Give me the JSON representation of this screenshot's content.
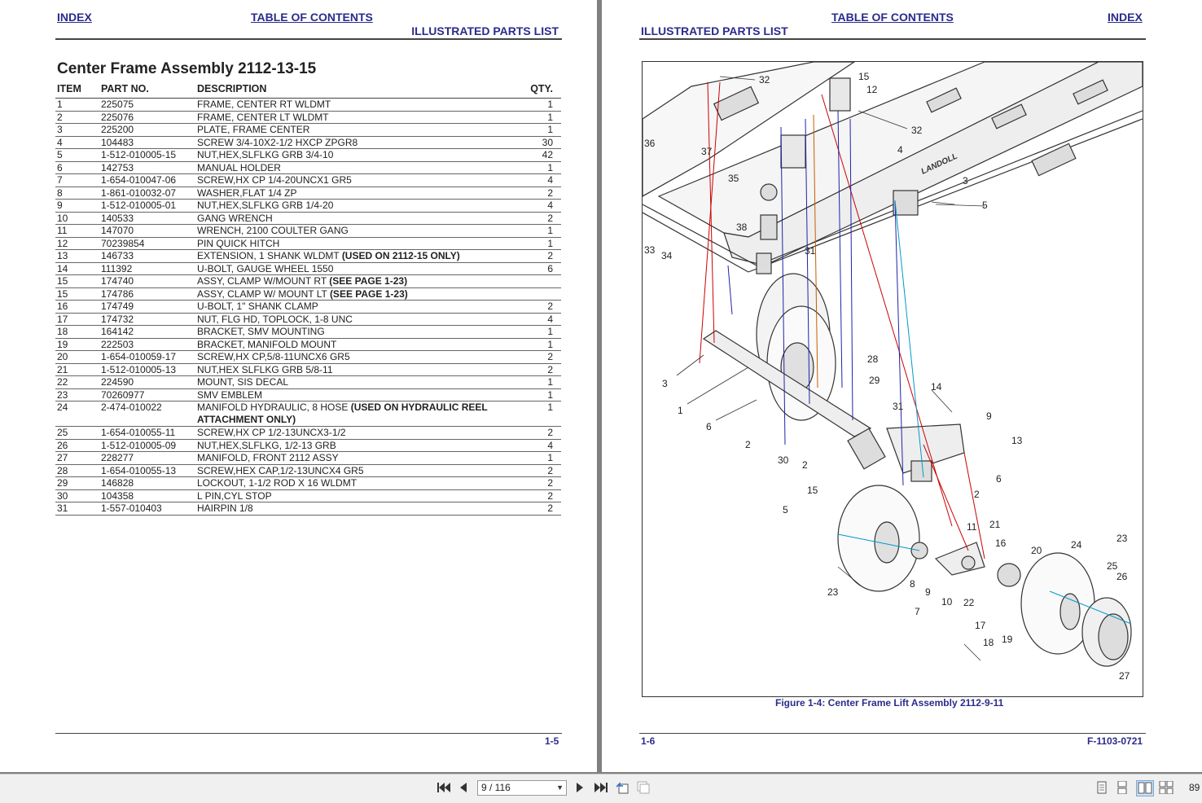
{
  "left_page": {
    "header": {
      "index_link": "INDEX",
      "toc_link": "TABLE OF CONTENTS",
      "section": "ILLUSTRATED PARTS LIST"
    },
    "title": "Center Frame Assembly 2112-13-15",
    "columns": [
      "ITEM",
      "PART NO.",
      "DESCRIPTION",
      "QTY."
    ],
    "rows": [
      {
        "item": "1",
        "part": "225075",
        "desc": "FRAME, CENTER RT WLDMT",
        "note": "",
        "desc2": "",
        "qty": "1"
      },
      {
        "item": "2",
        "part": "225076",
        "desc": "FRAME, CENTER LT WLDMT",
        "note": "",
        "desc2": "",
        "qty": "1"
      },
      {
        "item": "3",
        "part": "225200",
        "desc": "PLATE, FRAME CENTER",
        "note": "",
        "desc2": "",
        "qty": "1"
      },
      {
        "item": "4",
        "part": "104483",
        "desc": "SCREW 3/4-10X2-1/2 HXCP ZPGR8",
        "note": "",
        "desc2": "",
        "qty": "30"
      },
      {
        "item": "5",
        "part": "1-512-010005-15",
        "desc": "NUT,HEX,SLFLKG GRB 3/4-10",
        "note": "",
        "desc2": "",
        "qty": "42"
      },
      {
        "item": "6",
        "part": "142753",
        "desc": "MANUAL HOLDER",
        "note": "",
        "desc2": "",
        "qty": "1"
      },
      {
        "item": "7",
        "part": "1-654-010047-06",
        "desc": "SCREW,HX CP 1/4-20UNCX1 GR5",
        "note": "",
        "desc2": "",
        "qty": "4"
      },
      {
        "item": "8",
        "part": "1-861-010032-07",
        "desc": "WASHER,FLAT 1/4 ZP",
        "note": "",
        "desc2": "",
        "qty": "2"
      },
      {
        "item": "9",
        "part": "1-512-010005-01",
        "desc": "NUT,HEX,SLFLKG GRB 1/4-20",
        "note": "",
        "desc2": "",
        "qty": "4"
      },
      {
        "item": "10",
        "part": "140533",
        "desc": "GANG WRENCH",
        "note": "",
        "desc2": "",
        "qty": "2"
      },
      {
        "item": "11",
        "part": "147070",
        "desc": "WRENCH, 2100 COULTER GANG",
        "note": "",
        "desc2": "",
        "qty": "1"
      },
      {
        "item": "12",
        "part": "70239854",
        "desc": "PIN QUICK HITCH",
        "note": "",
        "desc2": "",
        "qty": "1"
      },
      {
        "item": "13",
        "part": "146733",
        "desc": "EXTENSION, 1 SHANK WLDMT ",
        "note": "(USED ON 2112-15 ONLY)",
        "desc2": "",
        "qty": "2"
      },
      {
        "item": "14",
        "part": "111392",
        "desc": "U-BOLT, GAUGE WHEEL 1550",
        "note": "",
        "desc2": "",
        "qty": "6"
      },
      {
        "item": "15",
        "part": "174740",
        "desc": "ASSY, CLAMP W/MOUNT RT ",
        "note": "(SEE PAGE 1-23)",
        "desc2": "",
        "qty": ""
      },
      {
        "item": "15",
        "part": "174786",
        "desc": "ASSY, CLAMP W/ MOUNT LT ",
        "note": "(SEE PAGE 1-23)",
        "desc2": "",
        "qty": ""
      },
      {
        "item": "16",
        "part": "174749",
        "desc": "U-BOLT, 1\" SHANK CLAMP",
        "note": "",
        "desc2": "",
        "qty": "2"
      },
      {
        "item": "17",
        "part": "174732",
        "desc": "NUT, FLG HD, TOPLOCK, 1-8 UNC",
        "note": "",
        "desc2": "",
        "qty": "4"
      },
      {
        "item": "18",
        "part": "164142",
        "desc": "BRACKET, SMV MOUNTING",
        "note": "",
        "desc2": "",
        "qty": "1"
      },
      {
        "item": "19",
        "part": "222503",
        "desc": "BRACKET, MANIFOLD MOUNT",
        "note": "",
        "desc2": "",
        "qty": "1"
      },
      {
        "item": "20",
        "part": "1-654-010059-17",
        "desc": "SCREW,HX CP,5/8-11UNCX6 GR5",
        "note": "",
        "desc2": "",
        "qty": "2"
      },
      {
        "item": "21",
        "part": "1-512-010005-13",
        "desc": "NUT,HEX SLFLKG GRB 5/8-11",
        "note": "",
        "desc2": "",
        "qty": "2"
      },
      {
        "item": "22",
        "part": "224590",
        "desc": "MOUNT, SIS DECAL",
        "note": "",
        "desc2": "",
        "qty": "1"
      },
      {
        "item": "23",
        "part": "70260977",
        "desc": "SMV EMBLEM",
        "note": "",
        "desc2": "",
        "qty": "1"
      },
      {
        "item": "24",
        "part": "2-474-010022",
        "desc": "MANIFOLD HYDRAULIC, 8 HOSE ",
        "note": "(USED ON HYDRAULIC REEL",
        "desc2": "ATTACHMENT ONLY)",
        "qty": "1"
      },
      {
        "item": "25",
        "part": "1-654-010055-11",
        "desc": "SCREW,HX CP 1/2-13UNCX3-1/2",
        "note": "",
        "desc2": "",
        "qty": "2"
      },
      {
        "item": "26",
        "part": "1-512-010005-09",
        "desc": "NUT,HEX,SLFLKG, 1/2-13 GRB",
        "note": "",
        "desc2": "",
        "qty": "4"
      },
      {
        "item": "27",
        "part": "228277",
        "desc": "MANIFOLD, FRONT 2112 ASSY",
        "note": "",
        "desc2": "",
        "qty": "1"
      },
      {
        "item": "28",
        "part": "1-654-010055-13",
        "desc": "SCREW,HEX CAP,1/2-13UNCX4 GR5",
        "note": "",
        "desc2": "",
        "qty": "2"
      },
      {
        "item": "29",
        "part": "146828",
        "desc": "LOCKOUT, 1-1/2 ROD X 16 WLDMT",
        "note": "",
        "desc2": "",
        "qty": "2"
      },
      {
        "item": "30",
        "part": "104358",
        "desc": "L PIN,CYL STOP",
        "note": "",
        "desc2": "",
        "qty": "2"
      },
      {
        "item": "31",
        "part": "1-557-010403",
        "desc": "HAIRPIN 1/8",
        "note": "",
        "desc2": "",
        "qty": "2"
      }
    ],
    "page_number": "1-5"
  },
  "right_page": {
    "header": {
      "toc_link": "TABLE OF CONTENTS",
      "index_link": "INDEX",
      "section": "ILLUSTRATED PARTS LIST"
    },
    "figure_caption": "Figure 1-4:   Center Frame Lift Assembly 2112-9-11",
    "brand_decal": "LANDOLL",
    "callouts": [
      "32",
      "15",
      "12",
      "32",
      "36",
      "37",
      "4",
      "3",
      "5",
      "35",
      "38",
      "31",
      "33",
      "34",
      "28",
      "29",
      "3",
      "1",
      "6",
      "2",
      "31",
      "14",
      "9",
      "13",
      "30",
      "2",
      "15",
      "6",
      "5",
      "2",
      "11",
      "21",
      "16",
      "20",
      "24",
      "23",
      "25",
      "26",
      "8",
      "9",
      "10",
      "22",
      "17",
      "18",
      "19",
      "7",
      "23",
      "27"
    ],
    "page_number": "1-6",
    "doc_number": "F-1103-0721"
  },
  "toolbar": {
    "page_indicator": "9 / 116",
    "zoom": "89",
    "icons": [
      "first-page-icon",
      "prev-page-icon",
      "next-page-icon",
      "last-page-icon",
      "rotate-left-icon",
      "rotate-right-icon",
      "single-page-icon",
      "continuous-icon",
      "two-page-icon",
      "two-page-continuous-icon"
    ]
  }
}
